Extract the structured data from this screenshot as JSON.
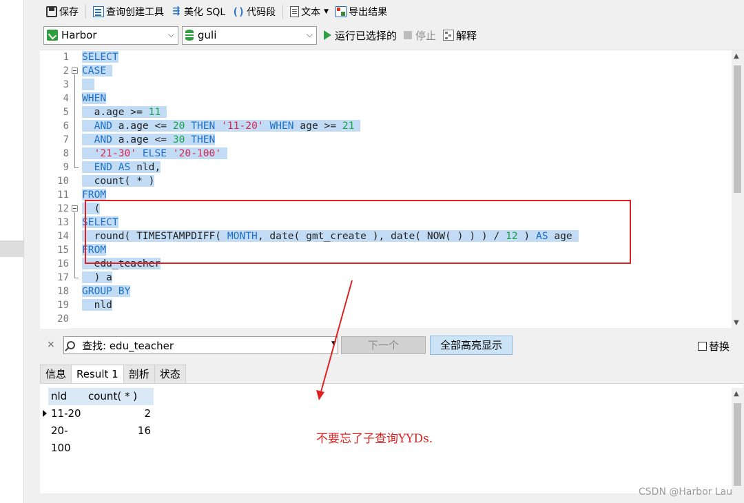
{
  "toolbar": {
    "save": "保存",
    "query_builder": "查询创建工具",
    "beautify_sql": "美化 SQL",
    "code_snippet": "代码段",
    "text": "文本",
    "export_result": "导出结果"
  },
  "row2": {
    "connection": "Harbor",
    "database": "guli",
    "run_selected": "运行已选择的",
    "stop": "停止",
    "explain": "解释"
  },
  "editor": {
    "line_numbers": [
      "1",
      "2",
      "3",
      "4",
      "5",
      "6",
      "7",
      "8",
      "9",
      "10",
      "11",
      "12",
      "13",
      "14",
      "15",
      "16",
      "17",
      "18",
      "19",
      "20"
    ],
    "lines": [
      [
        {
          "t": "SELECT",
          "c": "kw",
          "s": true
        }
      ],
      [
        {
          "t": "CASE",
          "c": "kw",
          "s": true
        },
        {
          "t": " ",
          "c": "id",
          "s": true
        }
      ],
      [
        {
          "t": "  ",
          "c": "id",
          "s": true
        }
      ],
      [
        {
          "t": "WHEN",
          "c": "kw",
          "s": true
        }
      ],
      [
        {
          "t": "  a.age >= ",
          "c": "id",
          "s": true
        },
        {
          "t": "11",
          "c": "num",
          "s": true
        },
        {
          "t": " ",
          "c": "id",
          "s": true
        }
      ],
      [
        {
          "t": "  ",
          "c": "id",
          "s": true
        },
        {
          "t": "AND",
          "c": "kw",
          "s": true
        },
        {
          "t": " a.age <= ",
          "c": "id",
          "s": true
        },
        {
          "t": "20",
          "c": "num",
          "s": true
        },
        {
          "t": " ",
          "c": "id",
          "s": true
        },
        {
          "t": "THEN",
          "c": "kw",
          "s": true
        },
        {
          "t": " ",
          "c": "id",
          "s": true
        },
        {
          "t": "'11-20'",
          "c": "str",
          "s": true
        },
        {
          "t": " ",
          "c": "id",
          "s": true
        },
        {
          "t": "WHEN",
          "c": "kw",
          "s": true
        },
        {
          "t": " age >= ",
          "c": "id",
          "s": true
        },
        {
          "t": "21",
          "c": "num",
          "s": true
        },
        {
          "t": " ",
          "c": "id",
          "s": true
        }
      ],
      [
        {
          "t": "  ",
          "c": "id",
          "s": true
        },
        {
          "t": "AND",
          "c": "kw",
          "s": true
        },
        {
          "t": " a.age <= ",
          "c": "id",
          "s": true
        },
        {
          "t": "30",
          "c": "num",
          "s": true
        },
        {
          "t": " ",
          "c": "id",
          "s": true
        },
        {
          "t": "THEN",
          "c": "kw",
          "s": true
        }
      ],
      [
        {
          "t": "  ",
          "c": "id",
          "s": true
        },
        {
          "t": "'21-30'",
          "c": "str",
          "s": true
        },
        {
          "t": " ",
          "c": "id",
          "s": true
        },
        {
          "t": "ELSE",
          "c": "kw",
          "s": true
        },
        {
          "t": " ",
          "c": "id",
          "s": true
        },
        {
          "t": "'20-100'",
          "c": "str",
          "s": true
        },
        {
          "t": " ",
          "c": "id",
          "s": true
        }
      ],
      [
        {
          "t": "  ",
          "c": "id",
          "s": true
        },
        {
          "t": "END",
          "c": "kw",
          "s": true
        },
        {
          "t": " ",
          "c": "id",
          "s": true
        },
        {
          "t": "AS",
          "c": "kw",
          "s": true
        },
        {
          "t": " nld,",
          "c": "id",
          "s": true
        }
      ],
      [
        {
          "t": "  count( * )",
          "c": "id",
          "s": true
        }
      ],
      [
        {
          "t": "FROM",
          "c": "kw",
          "s": true
        }
      ],
      [
        {
          "t": "  (",
          "c": "id",
          "s": true
        }
      ],
      [
        {
          "t": "SELECT",
          "c": "kw",
          "s": true
        }
      ],
      [
        {
          "t": "  round( TIMESTAMPDIFF( ",
          "c": "id",
          "s": true
        },
        {
          "t": "MONTH",
          "c": "kw",
          "s": true
        },
        {
          "t": ", date( gmt_create ), date( NOW( ) ) ) / ",
          "c": "id",
          "s": true
        },
        {
          "t": "12",
          "c": "num",
          "s": true
        },
        {
          "t": " ) ",
          "c": "id",
          "s": true
        },
        {
          "t": "AS",
          "c": "kw",
          "s": true
        },
        {
          "t": " age ",
          "c": "id",
          "s": true
        }
      ],
      [
        {
          "t": "FROM",
          "c": "kw",
          "s": true
        }
      ],
      [
        {
          "t": "  edu_teacher",
          "c": "id",
          "s": true
        }
      ],
      [
        {
          "t": "  ) a",
          "c": "id",
          "s": true
        }
      ],
      [
        {
          "t": "GROUP BY",
          "c": "kw",
          "s": true
        }
      ],
      [
        {
          "t": "  nld",
          "c": "id",
          "s": true
        }
      ],
      [
        {
          "t": "",
          "c": "id",
          "s": false
        }
      ]
    ]
  },
  "findbar": {
    "close": "×",
    "search_value": "查找: edu_teacher",
    "next": "下一个",
    "highlight_all": "全部高亮显示",
    "replace": "替换"
  },
  "tabs": [
    "信息",
    "Result 1",
    "剖析",
    "状态"
  ],
  "result": {
    "columns": [
      "nld",
      "count( * )"
    ],
    "rows": [
      [
        "11-20",
        "2"
      ],
      [
        "20-100",
        "16"
      ]
    ]
  },
  "annotation": "不要忘了子查询YYDs.",
  "watermark": "CSDN @Harbor Lau",
  "colors": {
    "keyword": "#1b6fc8",
    "number": "#16a34a",
    "string": "#d9254e",
    "selection": "#c2dcf5",
    "annotation_red": "#e02020"
  }
}
